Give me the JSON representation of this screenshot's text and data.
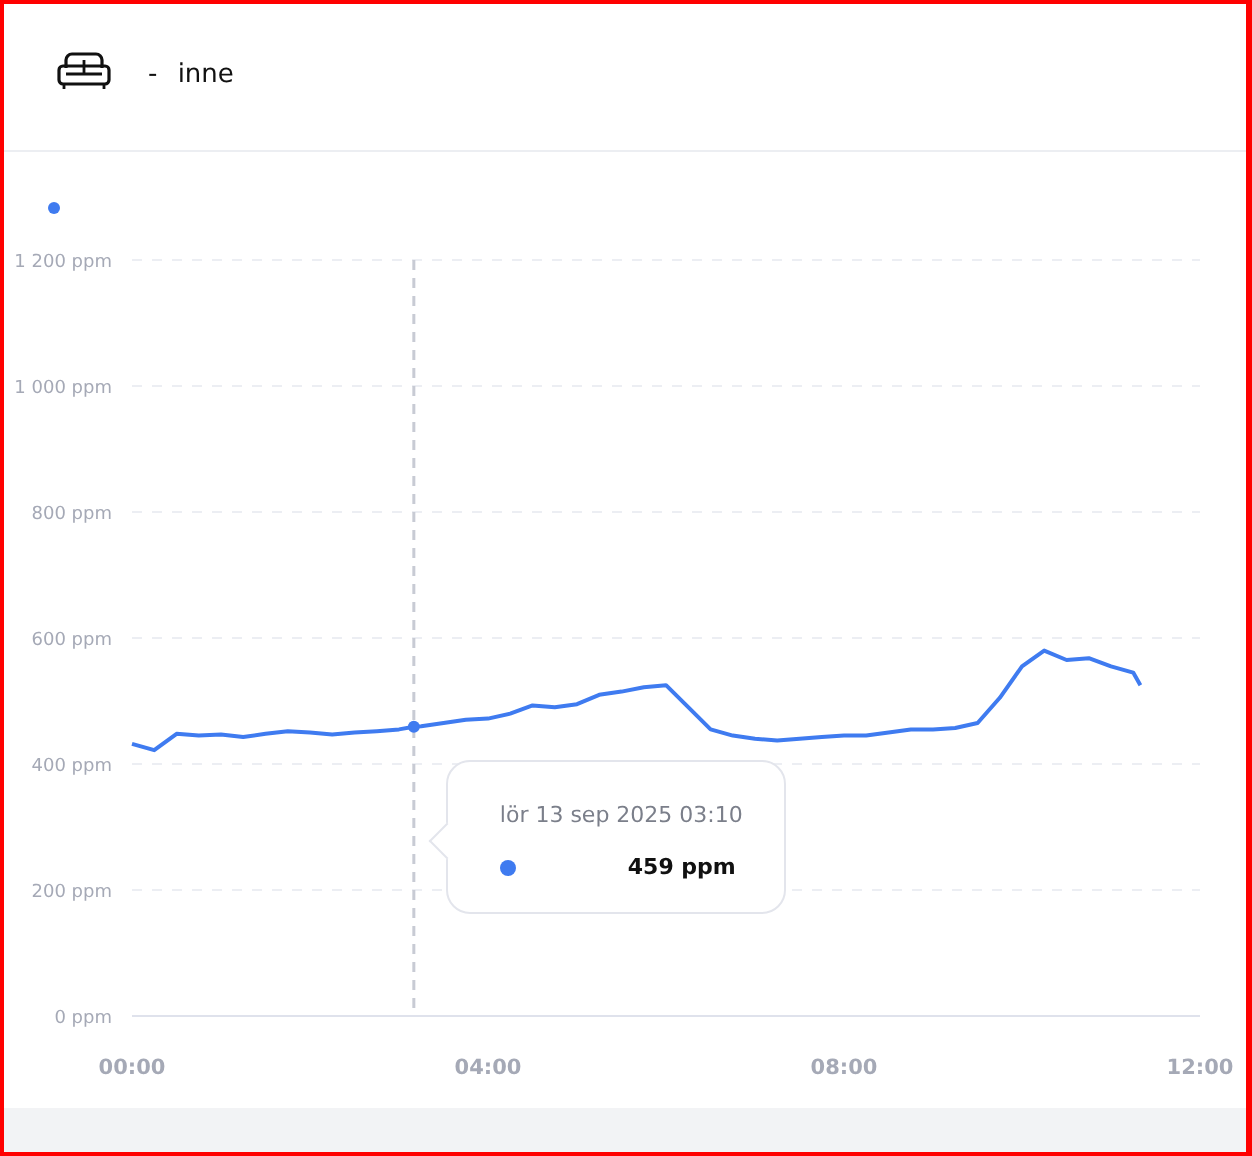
{
  "header": {
    "title": "- inne"
  },
  "chart": {
    "tooltip": {
      "date": "lör 13 sep 2025 03:10",
      "value": "459 ppm"
    },
    "chart_data": {
      "type": "line",
      "x": [
        0,
        0.25,
        0.5,
        0.75,
        1,
        1.25,
        1.5,
        1.75,
        2,
        2.25,
        2.5,
        2.75,
        3,
        3.1667,
        3.25,
        3.5,
        3.75,
        4,
        4.25,
        4.5,
        4.75,
        5,
        5.25,
        5.5,
        5.75,
        6,
        6.25,
        6.5,
        6.75,
        7,
        7.25,
        7.5,
        7.75,
        8,
        8.25,
        8.5,
        8.75,
        9,
        9.25,
        9.5,
        9.75,
        10,
        10.25,
        10.5,
        10.75,
        11,
        11.25,
        11.33
      ],
      "series": [
        {
          "color": "#3f7bf0",
          "values": [
            432,
            422,
            448,
            445,
            447,
            443,
            448,
            452,
            450,
            447,
            450,
            452,
            455,
            459,
            460,
            465,
            470,
            472,
            480,
            493,
            490,
            495,
            510,
            515,
            522,
            525,
            490,
            455,
            445,
            440,
            437,
            440,
            443,
            445,
            445,
            450,
            455,
            455,
            457,
            465,
            505,
            555,
            580,
            565,
            568,
            555,
            545,
            525
          ]
        }
      ],
      "xlim": [
        0,
        12
      ],
      "ylim": [
        0,
        1200
      ],
      "xticks": [
        {
          "value": 0,
          "label": "00:00"
        },
        {
          "value": 4,
          "label": "04:00"
        },
        {
          "value": 8,
          "label": "08:00"
        },
        {
          "value": 12,
          "label": "12:00"
        }
      ],
      "yticks": [
        {
          "value": 0,
          "label": "0 ppm"
        },
        {
          "value": 200,
          "label": "200 ppm"
        },
        {
          "value": 400,
          "label": "400 ppm"
        },
        {
          "value": 600,
          "label": "600 ppm"
        },
        {
          "value": 800,
          "label": "800 ppm"
        },
        {
          "value": 1000,
          "label": "1 000 ppm"
        },
        {
          "value": 1200,
          "label": "1 200 ppm"
        }
      ],
      "grid": true,
      "ref_lines": [
        {
          "axis": "x",
          "value": 3.1667
        }
      ]
    }
  }
}
